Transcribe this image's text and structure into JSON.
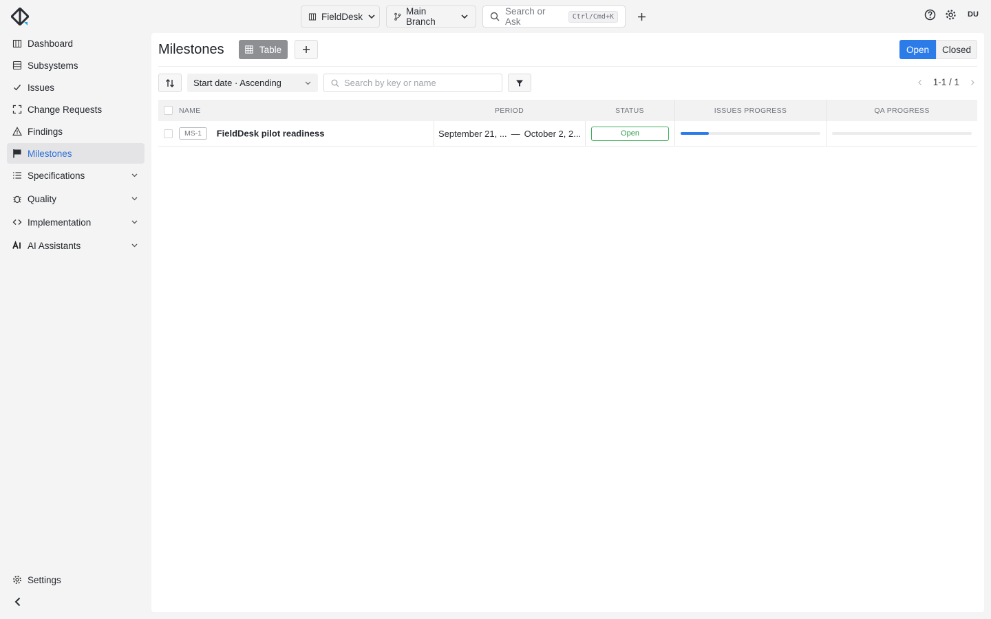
{
  "app": {
    "project_label": "FieldDesk",
    "branch_label": "Main Branch",
    "search_placeholder": "Search or Ask",
    "search_shortcut": "Ctrl/Cmd+K",
    "user_initials": "DU"
  },
  "sidebar": {
    "items": [
      {
        "label": "Dashboard",
        "icon": "building-icon"
      },
      {
        "label": "Subsystems",
        "icon": "server-icon"
      },
      {
        "label": "Issues",
        "icon": "check-icon"
      },
      {
        "label": "Change Requests",
        "icon": "expand-icon"
      },
      {
        "label": "Findings",
        "icon": "warning-icon"
      },
      {
        "label": "Milestones",
        "icon": "flag-icon",
        "active": true
      },
      {
        "label": "Specifications",
        "icon": "list-icon",
        "expandable": true
      },
      {
        "label": "Quality",
        "icon": "bug-icon",
        "expandable": true
      },
      {
        "label": "Implementation",
        "icon": "code-icon",
        "expandable": true
      },
      {
        "label": "AI Assistants",
        "icon": "ai-icon",
        "expandable": true
      }
    ],
    "settings_label": "Settings"
  },
  "page": {
    "title": "Milestones",
    "view_label": "Table",
    "filter_open": "Open",
    "filter_closed": "Closed"
  },
  "toolbar": {
    "sort_label": "Start date · Ascending",
    "search_placeholder": "Search by key or name",
    "pager_text": "1-1 / 1"
  },
  "table": {
    "columns": [
      "NAME",
      "PERIOD",
      "STATUS",
      "ISSUES PROGRESS",
      "QA PROGRESS"
    ],
    "rows": [
      {
        "key": "MS-1",
        "name": "FieldDesk pilot readiness",
        "start": "September 21, ...",
        "separator": "—",
        "end": "October 2, 2...",
        "status": "Open",
        "issues_progress": 0.2,
        "qa_progress": 0
      }
    ]
  },
  "colors": {
    "accent": "#2b7ce9",
    "status_open": "#3fae5a",
    "active_nav_bg": "#e4e4e7"
  }
}
